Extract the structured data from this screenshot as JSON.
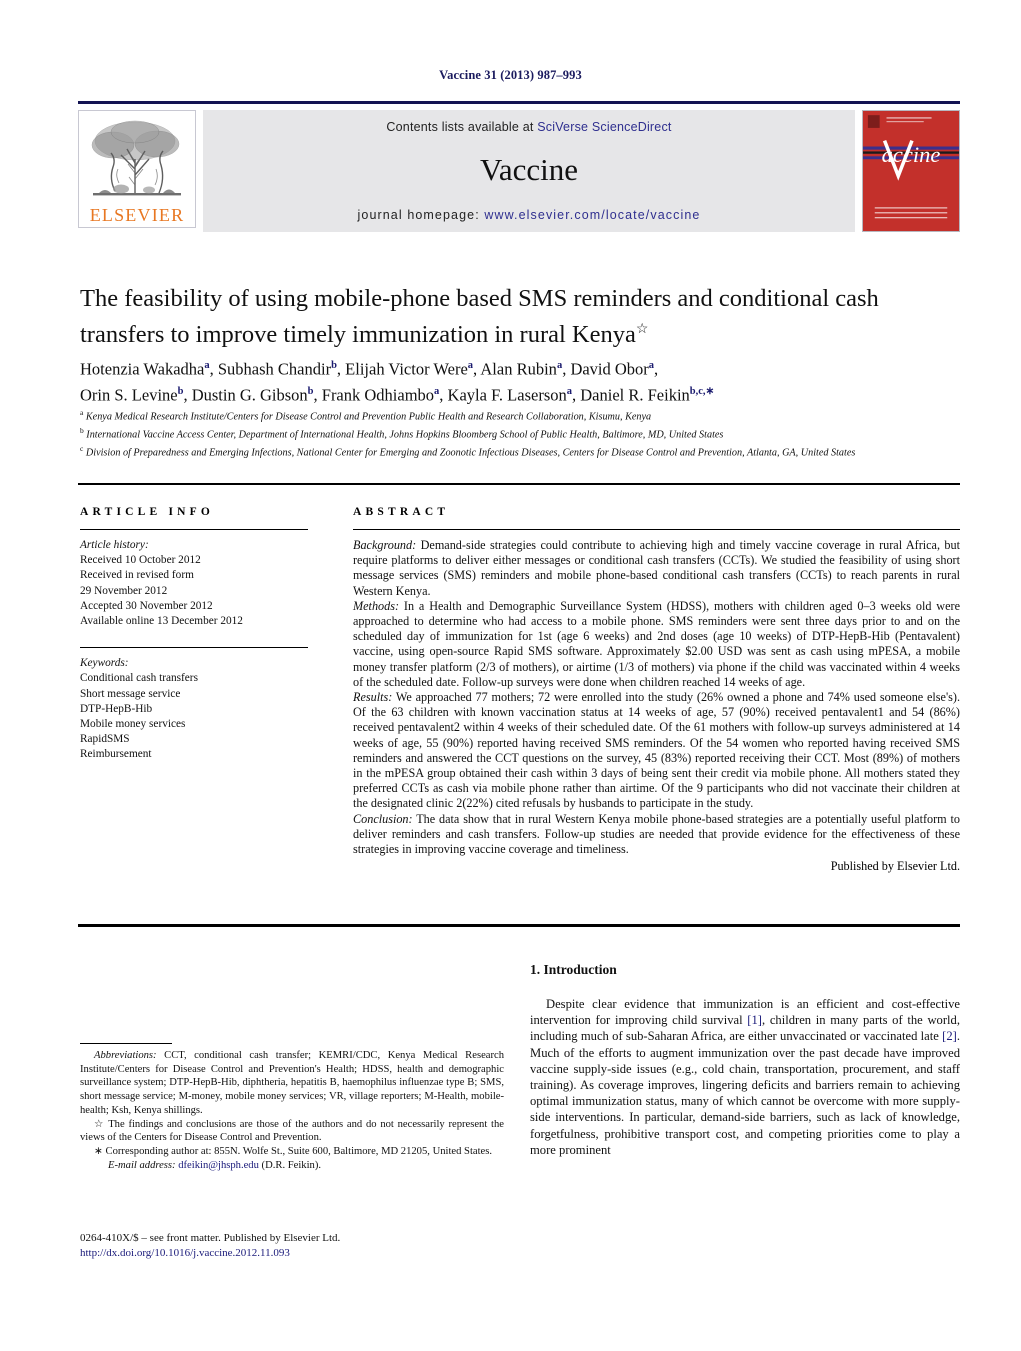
{
  "running_head": "Vaccine 31 (2013) 987–993",
  "masthead": {
    "contents_prefix": "Contents lists available at ",
    "contents_link": "SciVerse ScienceDirect",
    "journal_name": "Vaccine",
    "homepage_prefix": "journal homepage: ",
    "homepage_url": "www.elsevier.com/locate/vaccine",
    "publisher_wordmark": "ELSEVIER",
    "cover_title": "Vaccine",
    "cover_color": "#c3302b",
    "rule_color": "#131352",
    "panel_color": "#e6e6e8",
    "link_color": "#2f2f8f"
  },
  "article": {
    "title": "The feasibility of using mobile-phone based SMS reminders and conditional cash transfers to improve timely immunization in rural Kenya",
    "title_marker": "☆",
    "authors_line_1": "Hotenzia Wakadha<sup>a</sup>, Subhash Chandir<sup>b</sup>, Elijah Victor Were<sup>a</sup>, Alan Rubin<sup>a</sup>, David Obor<sup>a</sup>,",
    "authors_line_2": "Orin S. Levine<sup>b</sup>, Dustin G. Gibson<sup>b</sup>, Frank Odhiambo<sup>a</sup>, Kayla F. Laserson<sup>a</sup>, Daniel R. Feikin<sup>b,c,</sup><sup>∗</sup>",
    "affiliations": [
      "<sup>a</sup> Kenya Medical Research Institute/Centers for Disease Control and Prevention Public Health and Research Collaboration, Kisumu, Kenya",
      "<sup>b</sup> International Vaccine Access Center, Department of International Health, Johns Hopkins Bloomberg School of Public Health, Baltimore, MD, United States",
      "<sup>c</sup> Division of Preparedness and Emerging Infections, National Center for Emerging and Zoonotic Infectious Diseases, Centers for Disease Control and Prevention, Atlanta, GA, United States"
    ]
  },
  "article_info": {
    "heading": "ARTICLE INFO",
    "history_label": "Article history:",
    "history": [
      "Received 10 October 2012",
      "Received in revised form",
      "29 November 2012",
      "Accepted 30 November 2012",
      "Available online 13 December 2012"
    ],
    "keywords_label": "Keywords:",
    "keywords": [
      "Conditional cash transfers",
      "Short message service",
      "DTP-HepB-Hib",
      "Mobile money services",
      "RapidSMS",
      "Reimbursement"
    ]
  },
  "abstract": {
    "heading": "ABSTRACT",
    "sections": [
      {
        "label": "Background:",
        "text": " Demand-side strategies could contribute to achieving high and timely vaccine coverage in rural Africa, but require platforms to deliver either messages or conditional cash transfers (CCTs). We studied the feasibility of using short message services (SMS) reminders and mobile phone-based conditional cash transfers (CCTs) to reach parents in rural Western Kenya."
      },
      {
        "label": "Methods:",
        "text": " In a Health and Demographic Surveillance System (HDSS), mothers with children aged 0–3 weeks old were approached to determine who had access to a mobile phone. SMS reminders were sent three days prior to and on the scheduled day of immunization for 1st (age 6 weeks) and 2nd doses (age 10 weeks) of DTP-HepB-Hib (Pentavalent) vaccine, using open-source Rapid SMS software. Approximately $2.00 USD was sent as cash using mPESA, a mobile money transfer platform (2/3 of mothers), or airtime (1/3 of mothers) via phone if the child was vaccinated within 4 weeks of the scheduled date. Follow-up surveys were done when children reached 14 weeks of age."
      },
      {
        "label": "Results:",
        "text": " We approached 77 mothers; 72 were enrolled into the study (26% owned a phone and 74% used someone else's). Of the 63 children with known vaccination status at 14 weeks of age, 57 (90%) received pentavalent1 and 54 (86%) received pentavalent2 within 4 weeks of their scheduled date. Of the 61 mothers with follow-up surveys administered at 14 weeks of age, 55 (90%) reported having received SMS reminders. Of the 54 women who reported having received SMS reminders and answered the CCT questions on the survey, 45 (83%) reported receiving their CCT. Most (89%) of mothers in the mPESA group obtained their cash within 3 days of being sent their credit via mobile phone. All mothers stated they preferred CCTs as cash via mobile phone rather than airtime. Of the 9 participants who did not vaccinate their children at the designated clinic 2(22%) cited refusals by husbands to participate in the study."
      },
      {
        "label": "Conclusion:",
        "text": " The data show that in rural Western Kenya mobile phone-based strategies are a potentially useful platform to deliver reminders and cash transfers. Follow-up studies are needed that provide evidence for the effectiveness of these strategies in improving vaccine coverage and timeliness."
      }
    ],
    "signoff": "Published by Elsevier Ltd."
  },
  "introduction": {
    "heading": "1. Introduction",
    "paragraph_parts": {
      "p1a": "Despite clear evidence that immunization is an efficient and cost-effective intervention for improving child survival ",
      "ref1": "[1]",
      "p1b": ", children in many parts of the world, including much of sub-Saharan Africa, are either unvaccinated or vaccinated late ",
      "ref2": "[2]",
      "p1c": ". Much of the efforts to augment immunization over the past decade have improved vaccine supply-side issues (e.g., cold chain, transportation, procurement, and staff training). As coverage improves, lingering deficits and barriers remain to achieving optimal immunization status, many of which cannot be overcome with more supply-side interventions. In particular, demand-side barriers, such as lack of knowledge, forgetfulness, prohibitive transport cost, and competing priorities come to play a more prominent"
    }
  },
  "footnotes": {
    "abbrev_label": "Abbreviations:",
    "abbrev_text": "  CCT, conditional cash transfer; KEMRI/CDC, Kenya Medical Research Institute/Centers for Disease Control and Prevention's Health; HDSS, health and demographic surveillance system; DTP-HepB-Hib, diphtheria, hepatitis B, haemophilus influenzae type B; SMS, short message service; M-money, mobile money services; VR, village reporters; M-Health, mobile-health; Ksh, Kenya shillings.",
    "star_marker": "☆",
    "star_text": " The findings and conclusions are those of the authors and do not necessarily represent the views of the Centers for Disease Control and Prevention.",
    "corresponding_marker": "∗",
    "corresponding_text": " Corresponding author at: 855N. Wolfe St., Suite 600, Baltimore, MD 21205, United States.",
    "email_label": "E-mail address:",
    "email": "dfeikin@jhsph.edu",
    "email_suffix": " (D.R. Feikin)."
  },
  "imprint": {
    "issn_line": "0264-410X/$ – see front matter. Published by Elsevier Ltd.",
    "doi": "http://dx.doi.org/10.1016/j.vaccine.2012.11.093"
  }
}
